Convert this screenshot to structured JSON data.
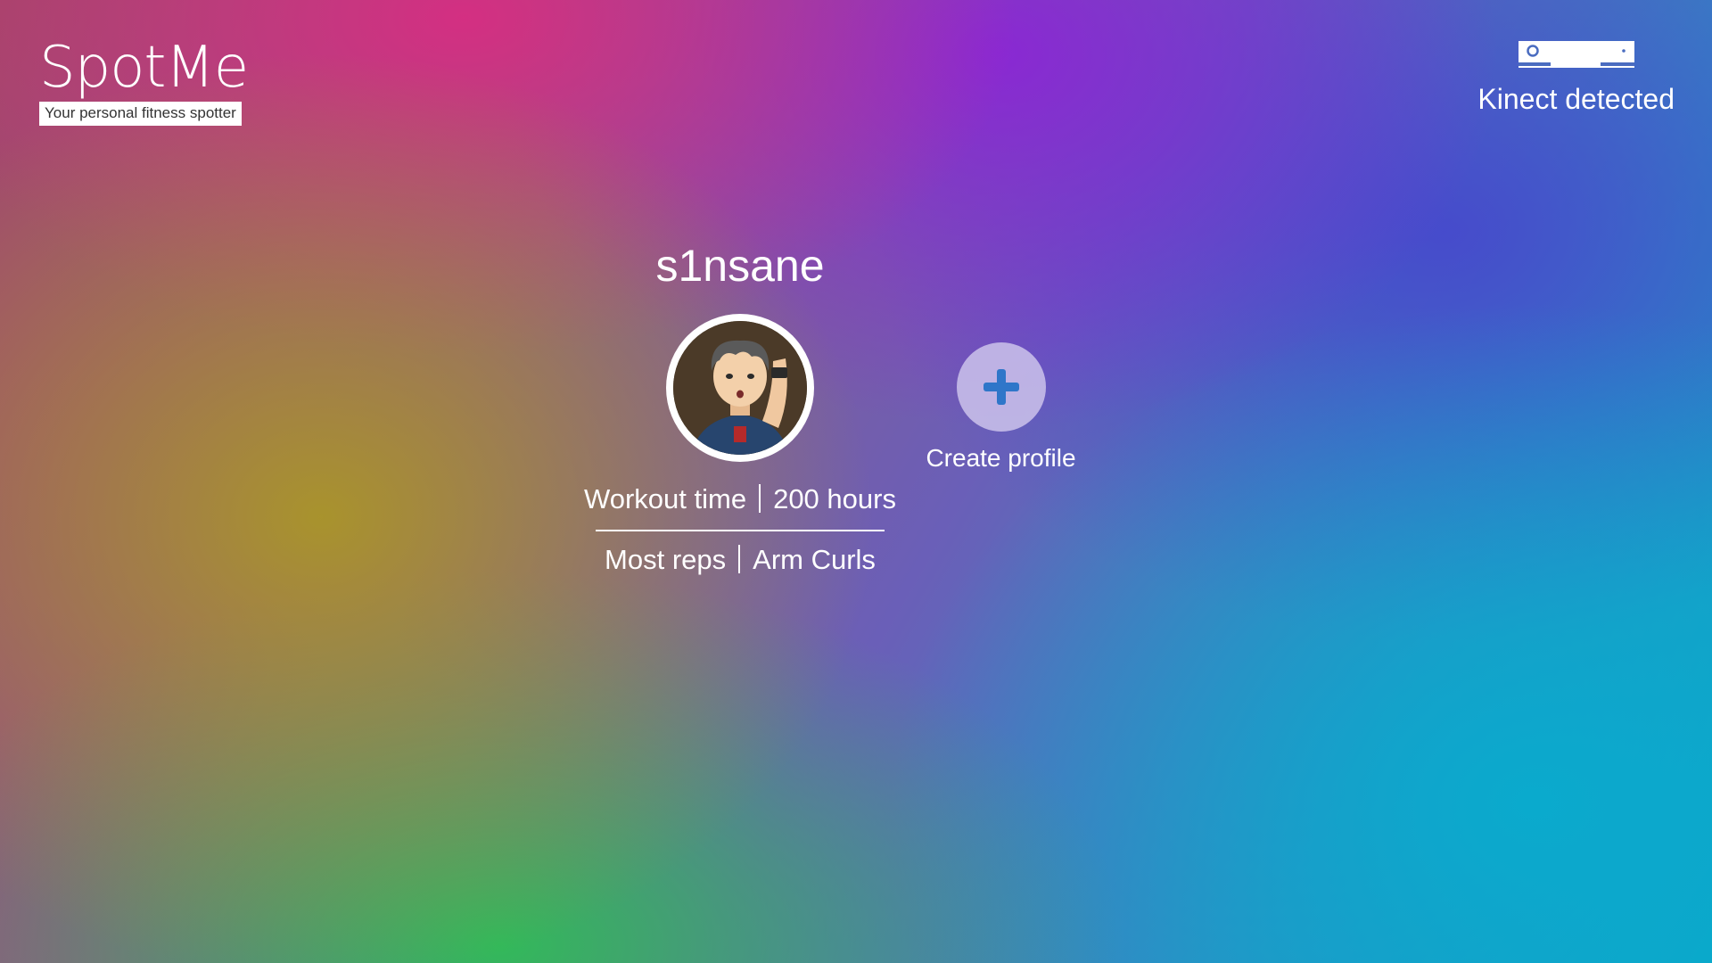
{
  "app": {
    "title": "SpotMe",
    "tagline": "Your personal fitness spotter"
  },
  "kinect": {
    "status_label": "Kinect detected",
    "icon": "kinect-sensor-icon"
  },
  "profile": {
    "name": "s1nsane",
    "avatar": "xbox-avatar",
    "stats": [
      {
        "label": "Workout time",
        "value": "200 hours"
      },
      {
        "label": "Most reps",
        "value": "Arm Curls"
      }
    ]
  },
  "create_profile": {
    "label": "Create profile",
    "icon": "plus-icon"
  },
  "colors": {
    "accent": "#2f76c9",
    "text": "#ffffff"
  }
}
